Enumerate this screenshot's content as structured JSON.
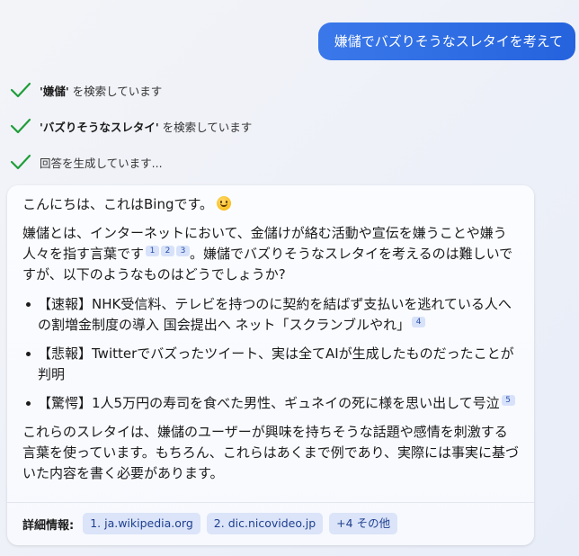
{
  "user_message": "嫌儲でバズりそうなスレタイを考えて",
  "progress": [
    {
      "quoted": "'嫌儲'",
      "suffix": " を検索しています"
    },
    {
      "quoted": "'バズりそうなスレタイ'",
      "suffix": " を検索しています"
    },
    {
      "quoted": "",
      "suffix": "回答を生成しています..."
    }
  ],
  "answer": {
    "greeting": "こんにちは、これはBingです。",
    "greeting_emoji": "smiling-face-icon",
    "intro": "嫌儲とは、インターネットにおいて、金儲けが絡む活動や宣伝を嫌うことや嫌う人々を指す言葉です",
    "intro_cites": [
      "1",
      "2",
      "3"
    ],
    "intro_tail": "。嫌儲でバズりそうなスレタイを考えるのは難しいですが、以下のようなものはどうでしょうか?",
    "items": [
      {
        "text": "【速報】NHK受信料、テレビを持つのに契約を結ばず支払いを逃れている人への割増金制度の導入 国会提出へ ネット「スクランブルやれ」",
        "cite": "4"
      },
      {
        "text": "【悲報】Twitterでバズったツイート、実は全てAIが生成したものだったことが判明",
        "cite": ""
      },
      {
        "text": "【驚愕】1人5万円の寿司を食べた男性、ギュネイの死に様を思い出して号泣",
        "cite": "5"
      }
    ],
    "closing": "これらのスレタイは、嫌儲のユーザーが興味を持ちそうな話題や感情を刺激する言葉を使っています。もちろん、これらはあくまで例であり、実際には事実に基づいた内容を書く必要があります。"
  },
  "footer": {
    "label": "詳細情報:",
    "links": [
      "1. ja.wikipedia.org",
      "2. dic.nicovideo.jp",
      "+4 その他"
    ]
  },
  "colors": {
    "accent": "#2f6fe4",
    "check": "#1f9d3a",
    "citation_bg": "#d7e2fa",
    "pill_bg": "#dbe4f8"
  }
}
